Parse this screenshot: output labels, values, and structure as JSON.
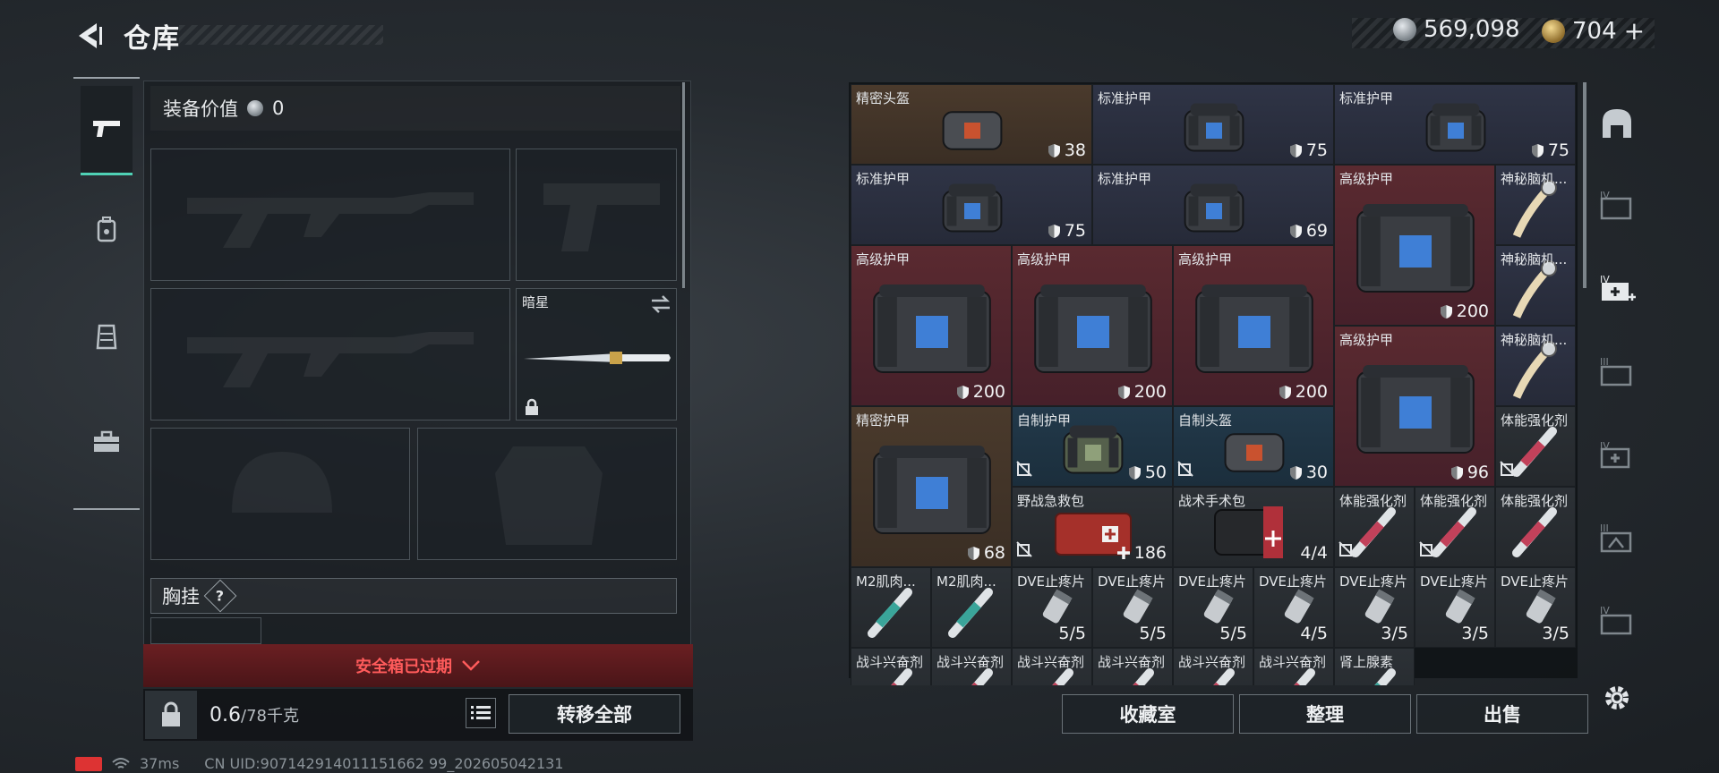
{
  "header": {
    "title": "仓库",
    "currency_a": "569,098",
    "currency_b": "704",
    "currency_b_plus": "+"
  },
  "left": {
    "equip_value_label": "装备价值",
    "equip_value": "0",
    "melee_name": "暗星",
    "chest_rig_label": "胸挂",
    "chest_rig_help": "?",
    "secure_box_text": "安全箱已过期",
    "weight_current": "0.6",
    "weight_max": "/78千克",
    "transfer_all": "转移全部"
  },
  "right": {
    "buttons": {
      "collection": "收藏室",
      "sort": "整理",
      "sell": "出售"
    }
  },
  "inventory": [
    {
      "name": "精密头盔",
      "value": "38",
      "badge": "shield",
      "bg": "brown",
      "item": "helmet-red"
    },
    {
      "name": "标准护甲",
      "value": "75",
      "badge": "shield",
      "bg": "navy",
      "item": "vest"
    },
    {
      "name": "标准护甲",
      "value": "75",
      "badge": "shield",
      "bg": "navy",
      "item": "vest"
    },
    {
      "name": "标准护甲",
      "value": "75",
      "badge": "shield",
      "bg": "navy",
      "item": "vest"
    },
    {
      "name": "标准护甲",
      "value": "69",
      "badge": "shield",
      "bg": "navy",
      "item": "vest"
    },
    {
      "name": "高级护甲",
      "value": "200",
      "badge": "shield",
      "bg": "red",
      "item": "vest"
    },
    {
      "name": "神秘脑机...",
      "value": "",
      "badge": "",
      "bg": "navy",
      "item": "scroll"
    },
    {
      "name": "高级护甲",
      "value": "200",
      "badge": "shield",
      "bg": "red",
      "item": "vest"
    },
    {
      "name": "高级护甲",
      "value": "200",
      "badge": "shield",
      "bg": "red",
      "item": "vest"
    },
    {
      "name": "高级护甲",
      "value": "200",
      "badge": "shield",
      "bg": "red",
      "item": "vest"
    },
    {
      "name": "神秘脑机...",
      "value": "",
      "badge": "",
      "bg": "navy",
      "item": "scroll"
    },
    {
      "name": "高级护甲",
      "value": "96",
      "badge": "shield",
      "bg": "red",
      "item": "vest"
    },
    {
      "name": "神秘脑机...",
      "value": "",
      "badge": "",
      "bg": "navy",
      "item": "scroll"
    },
    {
      "name": "精密护甲",
      "value": "68",
      "badge": "shield",
      "bg": "brown",
      "item": "vest"
    },
    {
      "name": "自制护甲",
      "value": "50",
      "badge": "shield",
      "bg": "teal",
      "item": "vest-green",
      "nodrop": true
    },
    {
      "name": "自制头盔",
      "value": "30",
      "badge": "shield",
      "bg": "teal",
      "item": "helmet-red",
      "nodrop": true
    },
    {
      "name": "体能强化剂",
      "value": "",
      "badge": "",
      "bg": "gray",
      "item": "syringe-red",
      "nodrop": true
    },
    {
      "name": "野战急救包",
      "value": "186",
      "badge": "plus",
      "bg": "gray",
      "item": "medkit",
      "nodrop": true
    },
    {
      "name": "战术手术包",
      "value": "4/4",
      "badge": "",
      "bg": "gray",
      "item": "surgery"
    },
    {
      "name": "体能强化剂",
      "value": "",
      "badge": "",
      "bg": "gray",
      "item": "syringe-red",
      "nodrop": true
    },
    {
      "name": "体能强化剂",
      "value": "",
      "badge": "",
      "bg": "gray",
      "item": "syringe-red",
      "nodrop": true
    },
    {
      "name": "体能强化剂",
      "value": "",
      "badge": "",
      "bg": "gray",
      "item": "syringe-red"
    },
    {
      "name": "M2肌肉...",
      "value": "",
      "badge": "",
      "bg": "gray",
      "item": "syringe-teal"
    },
    {
      "name": "M2肌肉...",
      "value": "",
      "badge": "",
      "bg": "gray",
      "item": "syringe-teal"
    },
    {
      "name": "DVE止疼片",
      "value": "5/5",
      "badge": "",
      "bg": "gray",
      "item": "pill"
    },
    {
      "name": "DVE止疼片",
      "value": "5/5",
      "badge": "",
      "bg": "gray",
      "item": "pill"
    },
    {
      "name": "DVE止疼片",
      "value": "5/5",
      "badge": "",
      "bg": "gray",
      "item": "pill"
    },
    {
      "name": "DVE止疼片",
      "value": "4/5",
      "badge": "",
      "bg": "gray",
      "item": "pill"
    },
    {
      "name": "DVE止疼片",
      "value": "3/5",
      "badge": "",
      "bg": "gray",
      "item": "pill"
    },
    {
      "name": "DVE止疼片",
      "value": "3/5",
      "badge": "",
      "bg": "gray",
      "item": "pill"
    },
    {
      "name": "DVE止疼片",
      "value": "3/5",
      "badge": "",
      "bg": "gray",
      "item": "pill"
    },
    {
      "name": "战斗兴奋剂",
      "value": "",
      "badge": "",
      "bg": "gray",
      "item": "syringe-red"
    },
    {
      "name": "战斗兴奋剂",
      "value": "",
      "badge": "",
      "bg": "gray",
      "item": "syringe-red"
    },
    {
      "name": "战斗兴奋剂",
      "value": "",
      "badge": "",
      "bg": "gray",
      "item": "syringe-red"
    },
    {
      "name": "战斗兴奋剂",
      "value": "",
      "badge": "",
      "bg": "gray",
      "item": "syringe-red"
    },
    {
      "name": "战斗兴奋剂",
      "value": "",
      "badge": "",
      "bg": "gray",
      "item": "syringe-red"
    },
    {
      "name": "战斗兴奋剂",
      "value": "",
      "badge": "",
      "bg": "gray",
      "item": "syringe-red"
    },
    {
      "name": "肾上腺素",
      "value": "",
      "badge": "",
      "bg": "gray",
      "item": "syringe-teal"
    }
  ],
  "status": {
    "ping": "37ms",
    "uid": "CN UID:907142914011151662 99_202605042131"
  }
}
